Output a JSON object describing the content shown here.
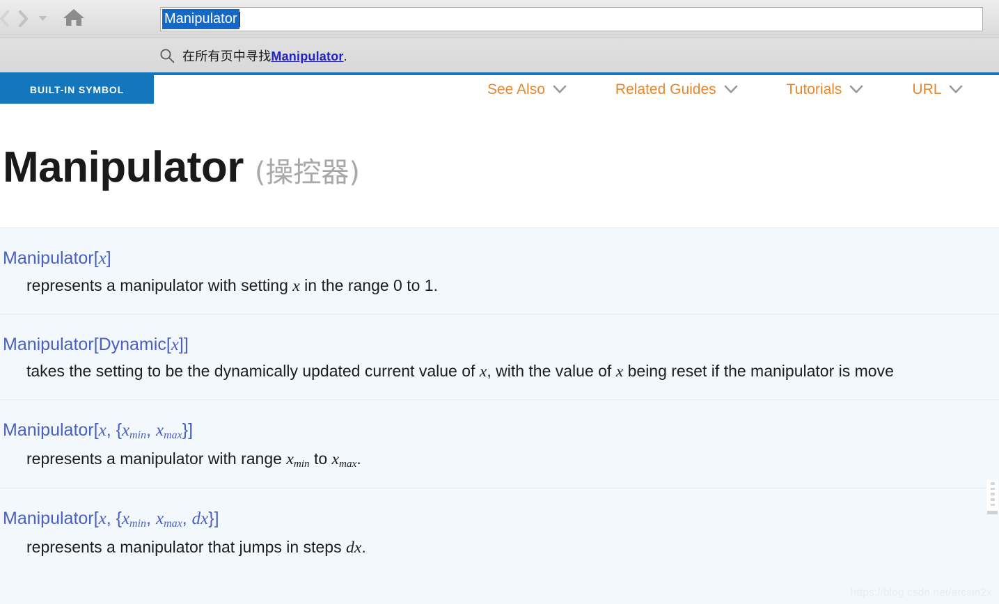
{
  "toolbar": {
    "back_icon": "chevron-left-icon",
    "forward_icon": "chevron-right-icon",
    "history_caret_icon": "caret-down-icon",
    "home_icon": "home-icon"
  },
  "search": {
    "value": "Manipulator",
    "placeholder": "Search",
    "selected": true
  },
  "suggestion": {
    "icon": "search-icon",
    "prefix": "在所有页中寻找",
    "term": "Manipulator",
    "suffix": "."
  },
  "page_header": {
    "badge": "BUILT-IN SYMBOL",
    "badge_color": "#1476bd",
    "rule_color": "#1476bd",
    "menus": [
      {
        "label": "See Also",
        "caret_icon": "chevron-down-icon"
      },
      {
        "label": "Related Guides",
        "caret_icon": "chevron-down-icon"
      },
      {
        "label": "Tutorials",
        "caret_icon": "chevron-down-icon"
      },
      {
        "label": "URL",
        "caret_icon": "chevron-down-icon"
      }
    ],
    "menu_color": "#e8862c"
  },
  "title": {
    "name": "Manipulator",
    "translation": "(操控器)"
  },
  "definitions": [
    {
      "signature_html": "Manipulator[<span class=\"mathvar\">x</span>]",
      "description_html": "represents a manipulator with setting <span class=\"mathvar\">x</span> in the range 0 to 1.",
      "signature_text": "Manipulator[x]",
      "description_text": "represents a manipulator with setting x in the range 0 to 1."
    },
    {
      "signature_html": "Manipulator[Dynamic[<span class=\"mathvar\">x</span>]]",
      "description_html": "takes the setting to be the dynamically updated current value of <span class=\"mathvar\">x</span>, with the value of <span class=\"mathvar\">x</span> being reset if the manipulator is move",
      "signature_text": "Manipulator[Dynamic[x]]",
      "description_text": "takes the setting to be the dynamically updated current value of x, with the value of x being reset if the manipulator is move"
    },
    {
      "signature_html": "Manipulator[<span class=\"mathvar\">x</span>, {<span class=\"mathvar\">x<sub>min</sub></span>, <span class=\"mathvar\">x<sub>max</sub></span>}]",
      "description_html": "represents a manipulator with range <span class=\"mathvar\">x<sub>min</sub></span> to <span class=\"mathvar\">x<sub>max</sub></span>.",
      "signature_text": "Manipulator[x, {xmin, xmax}]",
      "description_text": "represents a manipulator with range xmin to xmax."
    },
    {
      "signature_html": "Manipulator[<span class=\"mathvar\">x</span>, {<span class=\"mathvar\">x<sub>min</sub></span>, <span class=\"mathvar\">x<sub>max</sub></span>, <span class=\"mathvar\">dx</span>}]",
      "description_html": "represents a manipulator that jumps in steps <span class=\"mathvar\">dx</span>.",
      "signature_text": "Manipulator[x, {xmin, xmax, dx}]",
      "description_text": "represents a manipulator that jumps in steps dx."
    }
  ],
  "scrollbar": {
    "grip_icon": "scroll-grip-icon"
  },
  "watermark": "https://blog.csdn.net/arcsin2x"
}
